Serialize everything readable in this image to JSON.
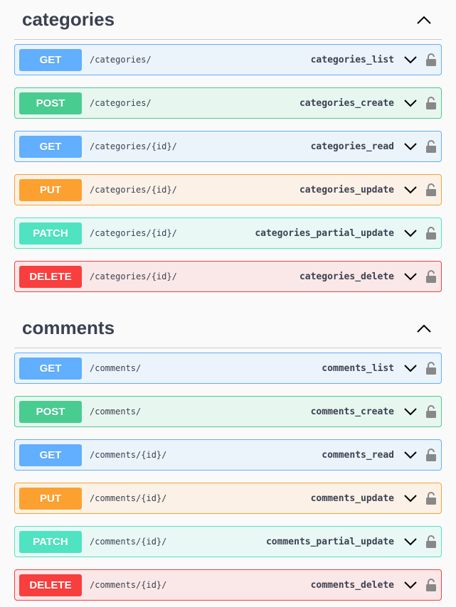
{
  "sections": [
    {
      "title": "categories",
      "operations": [
        {
          "method": "GET",
          "path": "/categories/",
          "operation_id": "categories_list"
        },
        {
          "method": "POST",
          "path": "/categories/",
          "operation_id": "categories_create"
        },
        {
          "method": "GET",
          "path": "/categories/{id}/",
          "operation_id": "categories_read"
        },
        {
          "method": "PUT",
          "path": "/categories/{id}/",
          "operation_id": "categories_update"
        },
        {
          "method": "PATCH",
          "path": "/categories/{id}/",
          "operation_id": "categories_partial_update"
        },
        {
          "method": "DELETE",
          "path": "/categories/{id}/",
          "operation_id": "categories_delete"
        }
      ]
    },
    {
      "title": "comments",
      "operations": [
        {
          "method": "GET",
          "path": "/comments/",
          "operation_id": "comments_list"
        },
        {
          "method": "POST",
          "path": "/comments/",
          "operation_id": "comments_create"
        },
        {
          "method": "GET",
          "path": "/comments/{id}/",
          "operation_id": "comments_read"
        },
        {
          "method": "PUT",
          "path": "/comments/{id}/",
          "operation_id": "comments_update"
        },
        {
          "method": "PATCH",
          "path": "/comments/{id}/",
          "operation_id": "comments_partial_update"
        },
        {
          "method": "DELETE",
          "path": "/comments/{id}/",
          "operation_id": "comments_delete"
        }
      ]
    }
  ],
  "colors": {
    "GET": "#61affe",
    "POST": "#49cc90",
    "PUT": "#fca130",
    "PATCH": "#50e3c2",
    "DELETE": "#f93e3e"
  },
  "icons": {
    "collapse": "chevron-up-icon",
    "expand": "chevron-down-icon",
    "auth": "lock-icon"
  }
}
